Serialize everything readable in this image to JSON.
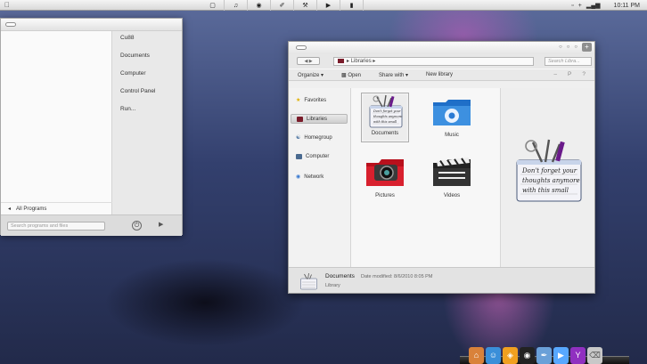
{
  "menubar": {
    "center_icons": [
      "folder-icon",
      "music-icon",
      "chrome-icon",
      "feather-icon",
      "wrench-icon",
      "play-icon",
      "bookmark-icon"
    ],
    "clock": "10:11 PM"
  },
  "start_menu": {
    "right_items": [
      "Cu88",
      "Documents",
      "Computer",
      "Control Panel",
      "Run..."
    ],
    "all_programs": "All Programs",
    "search_placeholder": "Search programs and files"
  },
  "explorer": {
    "address": "Libraries",
    "search_placeholder": "Search Libra...",
    "toolbar": {
      "organize": "Organize",
      "open": "Open",
      "share_with": "Share with",
      "new_library": "New library"
    },
    "nav": {
      "favorites": "Favorites",
      "libraries": "Libraries",
      "homegroup": "Homegroup",
      "computer": "Computer",
      "network": "Network"
    },
    "libraries": [
      {
        "label": "Documents",
        "icon": "note-icon"
      },
      {
        "label": "Music",
        "icon": "music-folder-icon"
      },
      {
        "label": "Pictures",
        "icon": "camera-folder-icon"
      },
      {
        "label": "Videos",
        "icon": "clapper-folder-icon"
      }
    ],
    "note_text": [
      "Don't forget your",
      "thoughts anymore",
      "with this small"
    ],
    "details": {
      "name": "Documents",
      "meta": "Date modified: 8/6/2010 8:05 PM",
      "type": "Library"
    }
  },
  "dock": {
    "icons": [
      "home-icon",
      "finder-icon",
      "fox-icon",
      "media-icon",
      "pen-icon",
      "arrow-icon",
      "yahoo-icon",
      "trash-icon"
    ],
    "colors": [
      "#d9823a",
      "#3a8fd9",
      "#f0a020",
      "#222222",
      "#6aa0d8",
      "#58a8ff",
      "#9030c0",
      "#c8c8c8"
    ]
  }
}
